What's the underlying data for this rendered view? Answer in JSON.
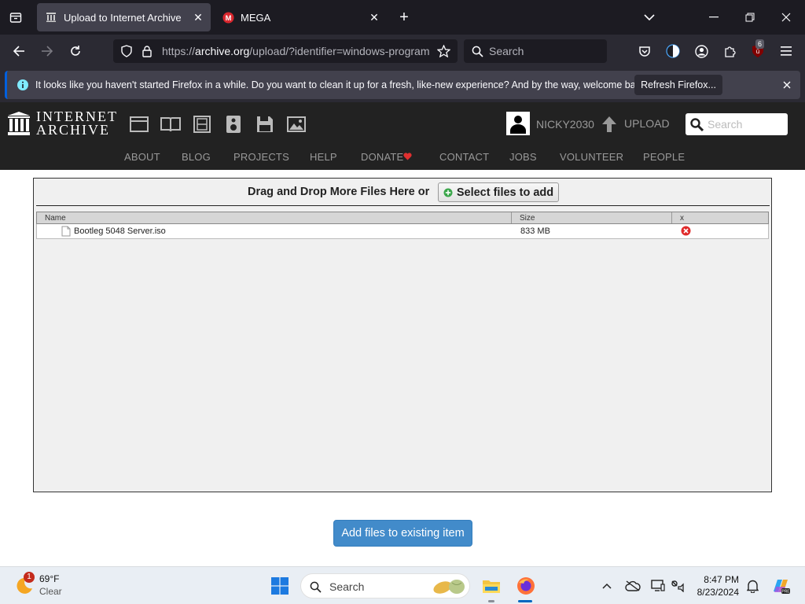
{
  "browser": {
    "tabs": [
      {
        "title": "Upload to Internet Archive",
        "active": true
      },
      {
        "title": "MEGA",
        "active": false
      }
    ],
    "url_prefix": "https://",
    "url_domain": "archive.org",
    "url_rest": "/upload/?identifier=windows-program",
    "search_placeholder": "Search",
    "extension_badge": "6",
    "notification": {
      "text": "It looks like you haven't started Firefox in a while. Do you want to clean it up for a fresh, like-new experience? And by the way, welcome back!",
      "button": "Refresh Firefox..."
    }
  },
  "ia": {
    "logo_line1": "INTERNET",
    "logo_line2": "ARCHIVE",
    "username": "NICKY2030",
    "upload_label": "UPLOAD",
    "search_placeholder": "Search",
    "nav": [
      "ABOUT",
      "BLOG",
      "PROJECTS",
      "HELP",
      "DONATE",
      "CONTACT",
      "JOBS",
      "VOLUNTEER",
      "PEOPLE"
    ]
  },
  "upload": {
    "drop_text": "Drag and Drop More Files Here or",
    "select_button": "Select files to add",
    "columns": {
      "name": "Name",
      "size": "Size",
      "x": "x"
    },
    "files": [
      {
        "name": "Bootleg 5048 Server.iso",
        "size": "833 MB"
      }
    ],
    "add_button": "Add files to existing item"
  },
  "taskbar": {
    "weather_temp": "69°F",
    "weather_desc": "Clear",
    "weather_badge": "1",
    "search_placeholder": "Search",
    "time": "8:47 PM",
    "date": "8/23/2024"
  },
  "colors": {
    "ia_header_bg": "#222222",
    "accent_button": "#428bca",
    "firefox_dark": "#1c1b22",
    "remove_red": "#e02b2b"
  }
}
